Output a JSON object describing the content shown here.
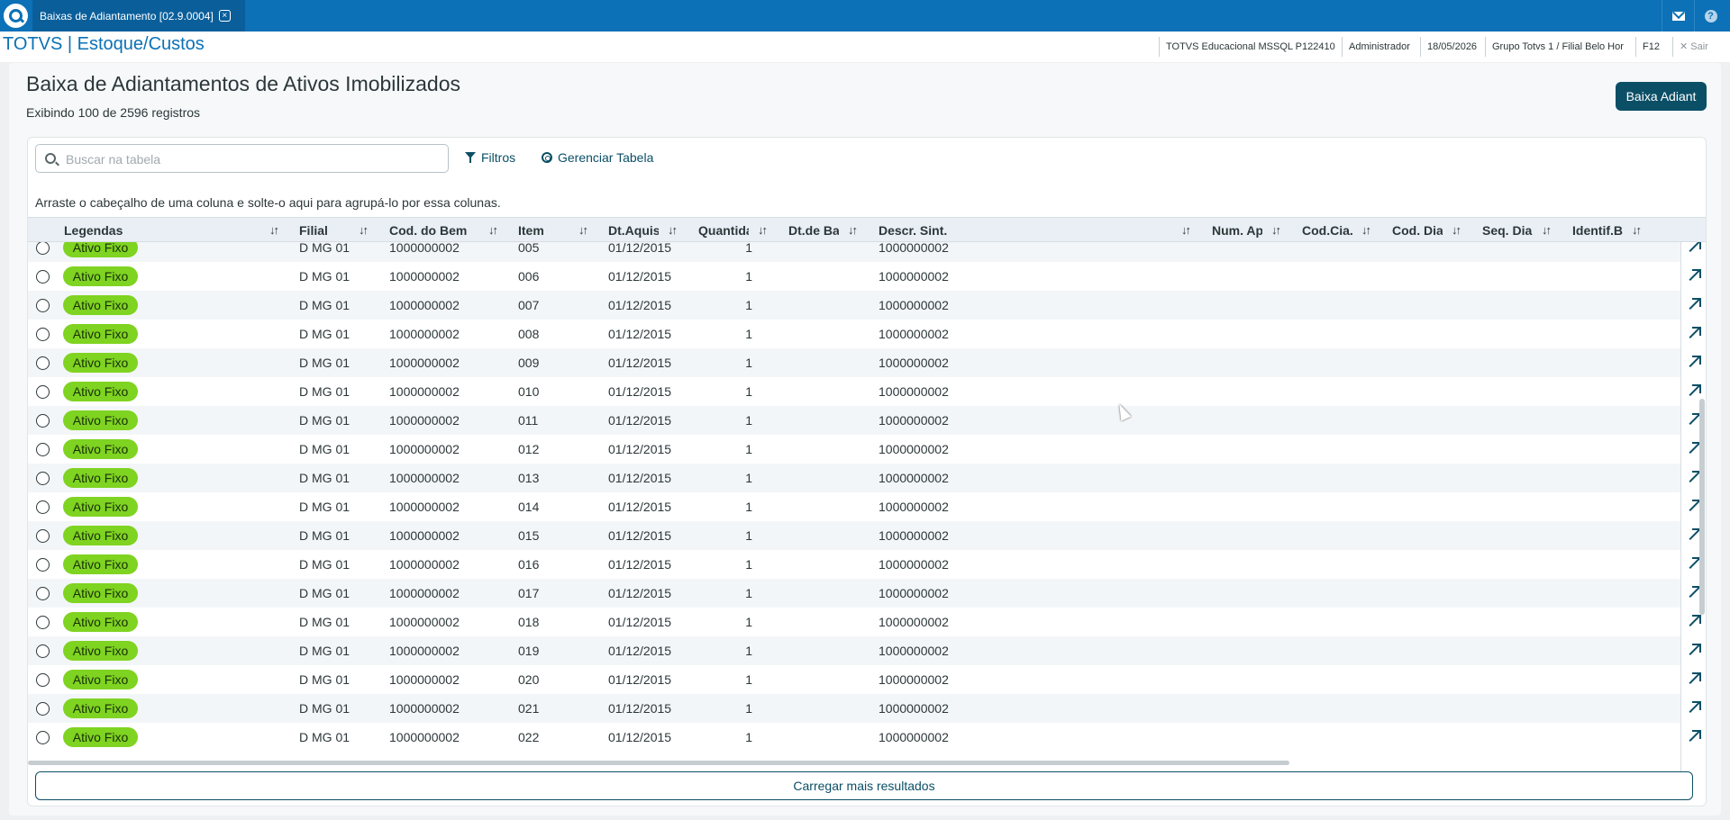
{
  "tab": {
    "title": "Baixas de Adiantamento [02.9.0004]",
    "close_symbol": "×"
  },
  "header": {
    "app_title": "TOTVS | Estoque/Custos",
    "environment": "TOTVS Educacional MSSQL P122410",
    "user": "Administrador",
    "date": "18/05/2026",
    "branch": "Grupo Totvs 1 / Filial Belo Hor",
    "shortcut": "F12",
    "exit_label": "✕  Sair"
  },
  "top_icons": {
    "mail": "mail-icon",
    "help": "help-icon",
    "help_glyph": "?"
  },
  "page": {
    "title": "Baixa de Adiantamentos de Ativos Imobilizados",
    "subtitle": "Exibindo 100 de 2596 registros",
    "action_button": "Baixa Adiant"
  },
  "toolbar": {
    "search_placeholder": "Buscar na tabela",
    "filters_label": "Filtros",
    "manage_table_label": "Gerenciar Tabela",
    "group_hint": "Arraste o cabeçalho de uma coluna e solte-o aqui para agrupá-lo por essa colunas."
  },
  "table": {
    "sort_glyph": "↓↑",
    "columns": [
      "Legendas",
      "Filial",
      "Cod. do Bem",
      "Item",
      "Dt.Aquis",
      "Quantida",
      "Dt.de Ba",
      "Descr. Sint.",
      "Num. Ap",
      "Cod.Cia.",
      "Cod. Dia",
      "Seq. Dia",
      "Identif.B"
    ],
    "rows": [
      {
        "legend": "Ativo Fixo",
        "filial": "D MG 01",
        "cod_bem": "1000000002",
        "item": "005",
        "dt_aquis": "01/12/2015",
        "quantidade": "1",
        "descr": "1000000002"
      },
      {
        "legend": "Ativo Fixo",
        "filial": "D MG 01",
        "cod_bem": "1000000002",
        "item": "006",
        "dt_aquis": "01/12/2015",
        "quantidade": "1",
        "descr": "1000000002"
      },
      {
        "legend": "Ativo Fixo",
        "filial": "D MG 01",
        "cod_bem": "1000000002",
        "item": "007",
        "dt_aquis": "01/12/2015",
        "quantidade": "1",
        "descr": "1000000002"
      },
      {
        "legend": "Ativo Fixo",
        "filial": "D MG 01",
        "cod_bem": "1000000002",
        "item": "008",
        "dt_aquis": "01/12/2015",
        "quantidade": "1",
        "descr": "1000000002"
      },
      {
        "legend": "Ativo Fixo",
        "filial": "D MG 01",
        "cod_bem": "1000000002",
        "item": "009",
        "dt_aquis": "01/12/2015",
        "quantidade": "1",
        "descr": "1000000002"
      },
      {
        "legend": "Ativo Fixo",
        "filial": "D MG 01",
        "cod_bem": "1000000002",
        "item": "010",
        "dt_aquis": "01/12/2015",
        "quantidade": "1",
        "descr": "1000000002"
      },
      {
        "legend": "Ativo Fixo",
        "filial": "D MG 01",
        "cod_bem": "1000000002",
        "item": "011",
        "dt_aquis": "01/12/2015",
        "quantidade": "1",
        "descr": "1000000002"
      },
      {
        "legend": "Ativo Fixo",
        "filial": "D MG 01",
        "cod_bem": "1000000002",
        "item": "012",
        "dt_aquis": "01/12/2015",
        "quantidade": "1",
        "descr": "1000000002"
      },
      {
        "legend": "Ativo Fixo",
        "filial": "D MG 01",
        "cod_bem": "1000000002",
        "item": "013",
        "dt_aquis": "01/12/2015",
        "quantidade": "1",
        "descr": "1000000002"
      },
      {
        "legend": "Ativo Fixo",
        "filial": "D MG 01",
        "cod_bem": "1000000002",
        "item": "014",
        "dt_aquis": "01/12/2015",
        "quantidade": "1",
        "descr": "1000000002"
      },
      {
        "legend": "Ativo Fixo",
        "filial": "D MG 01",
        "cod_bem": "1000000002",
        "item": "015",
        "dt_aquis": "01/12/2015",
        "quantidade": "1",
        "descr": "1000000002"
      },
      {
        "legend": "Ativo Fixo",
        "filial": "D MG 01",
        "cod_bem": "1000000002",
        "item": "016",
        "dt_aquis": "01/12/2015",
        "quantidade": "1",
        "descr": "1000000002"
      },
      {
        "legend": "Ativo Fixo",
        "filial": "D MG 01",
        "cod_bem": "1000000002",
        "item": "017",
        "dt_aquis": "01/12/2015",
        "quantidade": "1",
        "descr": "1000000002"
      },
      {
        "legend": "Ativo Fixo",
        "filial": "D MG 01",
        "cod_bem": "1000000002",
        "item": "018",
        "dt_aquis": "01/12/2015",
        "quantidade": "1",
        "descr": "1000000002"
      },
      {
        "legend": "Ativo Fixo",
        "filial": "D MG 01",
        "cod_bem": "1000000002",
        "item": "019",
        "dt_aquis": "01/12/2015",
        "quantidade": "1",
        "descr": "1000000002"
      },
      {
        "legend": "Ativo Fixo",
        "filial": "D MG 01",
        "cod_bem": "1000000002",
        "item": "020",
        "dt_aquis": "01/12/2015",
        "quantidade": "1",
        "descr": "1000000002"
      },
      {
        "legend": "Ativo Fixo",
        "filial": "D MG 01",
        "cod_bem": "1000000002",
        "item": "021",
        "dt_aquis": "01/12/2015",
        "quantidade": "1",
        "descr": "1000000002"
      },
      {
        "legend": "Ativo Fixo",
        "filial": "D MG 01",
        "cod_bem": "1000000002",
        "item": "022",
        "dt_aquis": "01/12/2015",
        "quantidade": "1",
        "descr": "1000000002"
      }
    ],
    "load_more": "Carregar mais resultados"
  },
  "colors": {
    "brand": "#0c71b6",
    "primary_button": "#0b4f66",
    "legend_badge": "#7fd321"
  }
}
